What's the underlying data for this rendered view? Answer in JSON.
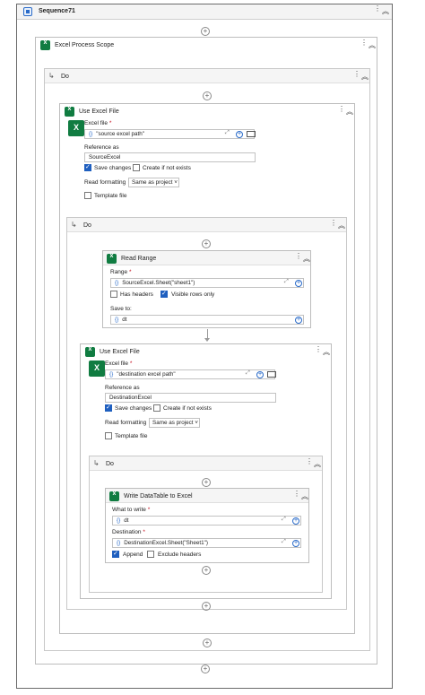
{
  "sequence": {
    "title": "Sequence71"
  },
  "excelScope": {
    "title": "Excel Process Scope"
  },
  "doLabel": "Do",
  "useExcel1": {
    "title": "Use Excel File",
    "excelFileLabel": "Excel file",
    "excelFileValue": "\"source excel path\"",
    "referenceAsLabel": "Reference as",
    "referenceAsValue": "SourceExcel",
    "saveChanges": "Save changes",
    "createIfNotExists": "Create if not exists",
    "readFormattingLabel": "Read formatting",
    "readFormattingValue": "Same as project",
    "templateFile": "Template file"
  },
  "readRange": {
    "title": "Read Range",
    "rangeLabel": "Range",
    "rangeValue": "SourceExcel.Sheet(\"sheet1\")",
    "hasHeaders": "Has headers",
    "visibleRowsOnly": "Visible rows only",
    "saveToLabel": "Save to",
    "saveToValue": "dt"
  },
  "useExcel2": {
    "title": "Use Excel File",
    "excelFileLabel": "Excel file",
    "excelFileValue": "\"destination excel path\"",
    "referenceAsLabel": "Reference as",
    "referenceAsValue": "DestinationExcel",
    "saveChanges": "Save changes",
    "createIfNotExists": "Create if not exists",
    "readFormattingLabel": "Read formatting",
    "readFormattingValue": "Same as project",
    "templateFile": "Template file"
  },
  "writeDT": {
    "title": "Write DataTable to Excel",
    "whatToWriteLabel": "What to write",
    "whatToWriteValue": "dt",
    "destinationLabel": "Destination",
    "destinationValue": "DestinationExcel.Sheet(\"Sheet1\")",
    "append": "Append",
    "excludeHeaders": "Exclude headers"
  },
  "symbols": {
    "required": "*",
    "braces": "{}",
    "plus": "+",
    "dots": "⋮",
    "collapse": "⌃"
  }
}
